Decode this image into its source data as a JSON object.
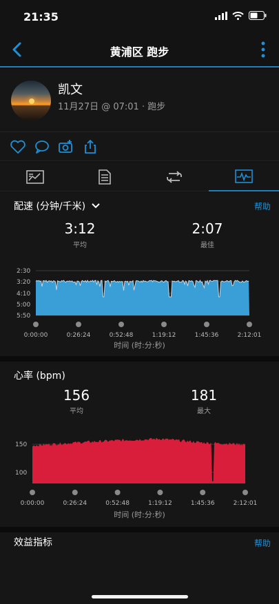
{
  "status_bar": {
    "time": "21:35"
  },
  "nav": {
    "title": "黄浦区 跑步"
  },
  "profile": {
    "name": "凯文",
    "meta": "11月27日 @ 07:01 · 跑步"
  },
  "pace": {
    "title": "配速 (分钟/千米)",
    "help": "帮助",
    "avg_value": "3:12",
    "avg_label": "平均",
    "best_value": "2:07",
    "best_label": "最佳",
    "y_ticks": [
      "2:30",
      "3:20",
      "4:10",
      "5:00",
      "5:50"
    ],
    "x_ticks": [
      "0:00:00",
      "0:26:24",
      "0:52:48",
      "1:19:12",
      "1:45:36",
      "2:12:01"
    ],
    "x_caption": "时间 (时:分:秒)",
    "color": "#3a9fd6"
  },
  "heart_rate": {
    "title": "心率 (bpm)",
    "avg_value": "156",
    "avg_label": "平均",
    "max_value": "181",
    "max_label": "最大",
    "y_ticks": [
      "150",
      "100"
    ],
    "x_ticks": [
      "0:00:00",
      "0:26:24",
      "0:52:48",
      "1:19:12",
      "1:45:36",
      "2:12:01"
    ],
    "x_caption": "时间 (时:分:秒)",
    "color": "#e0203c"
  },
  "benefit": {
    "title": "效益指标",
    "help": "帮助"
  },
  "chart_data": [
    {
      "type": "area",
      "title": "配速 (分钟/千米)",
      "xlabel": "时间 (时:分:秒)",
      "x": [
        "0:00:00",
        "0:26:24",
        "0:52:48",
        "1:19:12",
        "1:45:36",
        "2:12:01"
      ],
      "y_ticks": [
        "2:30",
        "3:20",
        "4:10",
        "5:00",
        "5:50"
      ],
      "series": [
        {
          "values": [
            3.2,
            3.2,
            3.25,
            3.2,
            3.2,
            3.2
          ]
        }
      ]
    },
    {
      "type": "area",
      "title": "心率 (bpm)",
      "xlabel": "时间 (时:分:秒)",
      "x": [
        "0:00:00",
        "0:26:24",
        "0:52:48",
        "1:19:12",
        "1:45:36",
        "2:12:01"
      ],
      "ylim": [
        80,
        181
      ],
      "series": [
        {
          "values": [
            148,
            153,
            157,
            160,
            153,
            150
          ]
        }
      ]
    }
  ]
}
